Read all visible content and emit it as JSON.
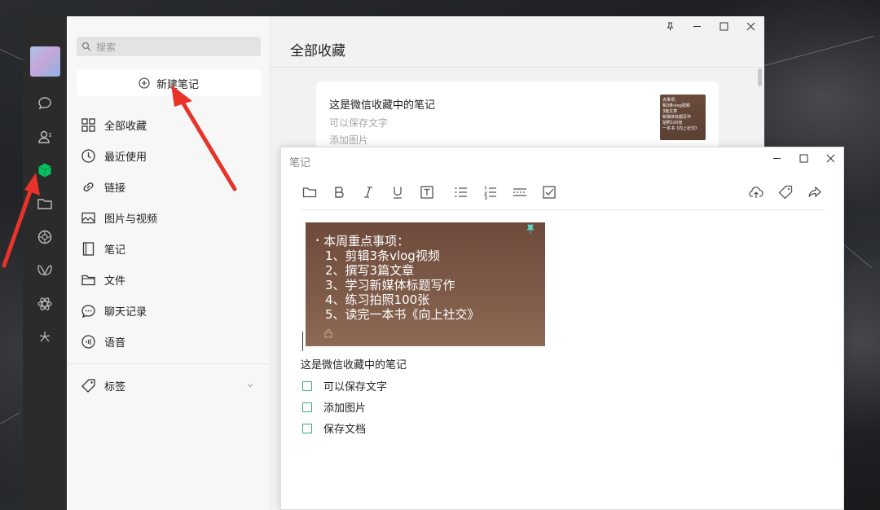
{
  "sidebar": {
    "search_placeholder": "搜索",
    "new_note_label": "新建笔记",
    "items": [
      {
        "label": "全部收藏",
        "icon": "grid-icon"
      },
      {
        "label": "最近使用",
        "icon": "clock-icon"
      },
      {
        "label": "链接",
        "icon": "link-icon"
      },
      {
        "label": "图片与视频",
        "icon": "image-icon"
      },
      {
        "label": "笔记",
        "icon": "notebook-icon"
      },
      {
        "label": "文件",
        "icon": "folder-icon"
      },
      {
        "label": "聊天记录",
        "icon": "chat-icon"
      },
      {
        "label": "语音",
        "icon": "voice-icon"
      }
    ],
    "tags_label": "标签"
  },
  "main": {
    "title": "全部收藏",
    "card": {
      "title": "这是微信收藏中的笔记",
      "line1": "可以保存文字",
      "line2": "添加图片",
      "thumb_lines": [
        "点事项:",
        "辑3条vlog视频",
        "3篇文章",
        "新媒体标题写作",
        "拍照100张",
        "一本书《向上社交》"
      ]
    }
  },
  "editor": {
    "title": "笔记",
    "image_text": {
      "heading": "本周重点事项：",
      "items": [
        "1、剪辑3条vlog视频",
        "2、撰写3篇文章",
        "3、学习新媒体标题写作",
        "4、练习拍照100张",
        "5、读完一本书《向上社交》"
      ]
    },
    "text_line": "这是微信收藏中的笔记",
    "checklist": [
      "可以保存文字",
      "添加图片",
      "保存文档"
    ]
  },
  "colors": {
    "rail_bg": "#2b2b2b",
    "accent_green": "#07c160",
    "checkbox_teal": "#3aa88c",
    "annotation_red": "#e8332a"
  }
}
